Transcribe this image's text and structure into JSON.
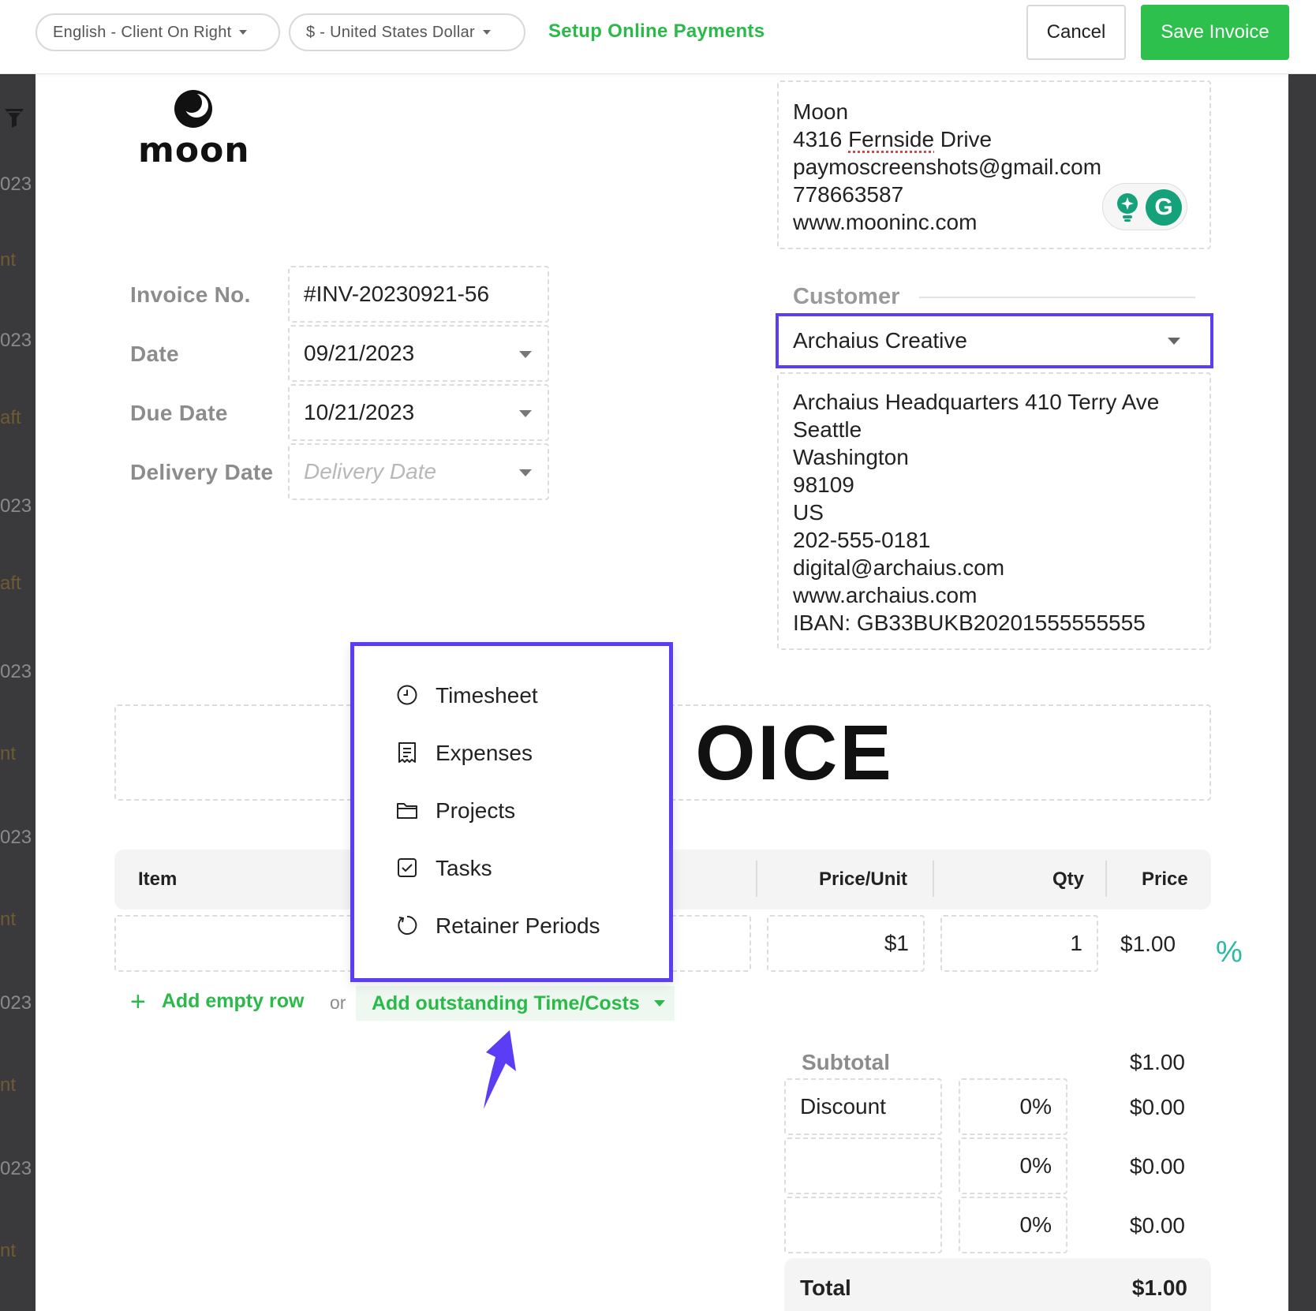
{
  "toolbar": {
    "language": "English - Client On Right",
    "currency": "$ - United States Dollar",
    "setup_payments": "Setup Online Payments",
    "cancel": "Cancel",
    "save": "Save Invoice"
  },
  "left_rail": [
    "023",
    "nt",
    "023",
    "aft",
    "023",
    "aft",
    "023",
    "nt",
    "023",
    "nt",
    "023",
    "nt",
    "023",
    "nt"
  ],
  "logo": {
    "word": "moon"
  },
  "company": {
    "lines": [
      "Moon",
      "4316 Fernside Drive",
      "paymoscreenshots@gmail.com",
      "778663587",
      "www.mooninc.com"
    ],
    "address_prefix": "4316 ",
    "address_flagged": "Fernside",
    "address_suffix": " Drive"
  },
  "grammarly": {
    "letter": "G"
  },
  "invoice_fields": {
    "invoice_no_label": "Invoice No.",
    "invoice_no": "#INV-20230921-56",
    "date_label": "Date",
    "date": "09/21/2023",
    "due_date_label": "Due Date",
    "due_date": "10/21/2023",
    "delivery_date_label": "Delivery Date",
    "delivery_date_placeholder": "Delivery Date"
  },
  "customer": {
    "label": "Customer",
    "selected": "Archaius Creative",
    "lines": [
      "Archaius Headquarters 410 Terry Ave",
      "Seattle",
      "Washington",
      "98109",
      "US",
      "202-555-0181",
      "digital@archaius.com",
      "www.archaius.com",
      "IBAN: GB33BUKB20201555555555"
    ]
  },
  "title": {
    "visible_text": "OICE"
  },
  "table": {
    "headers": {
      "item": "Item",
      "price_unit": "Price/Unit",
      "qty": "Qty",
      "price": "Price"
    },
    "row": {
      "price_unit": "$1",
      "qty": "1",
      "price": "$1.00"
    },
    "percent_icon": "%"
  },
  "actions": {
    "plus": "+",
    "add_empty_row": "Add empty row",
    "or": "or",
    "add_outstanding": "Add outstanding Time/Costs"
  },
  "dropdown": {
    "items": [
      {
        "label": "Timesheet",
        "icon": "clock-icon"
      },
      {
        "label": "Expenses",
        "icon": "receipt-icon"
      },
      {
        "label": "Projects",
        "icon": "folder-icon"
      },
      {
        "label": "Tasks",
        "icon": "checkbox-icon"
      },
      {
        "label": "Retainer Periods",
        "icon": "refresh-icon"
      }
    ]
  },
  "summary": {
    "subtotal_label": "Subtotal",
    "subtotal": "$1.00",
    "discount_label": "Discount",
    "discount_pct": "0%",
    "discount_val": "$0.00",
    "tax1_pct": "0%",
    "tax1_val": "$0.00",
    "tax2_pct": "0%",
    "tax2_val": "$0.00",
    "total_label": "Total",
    "total": "$1.00"
  },
  "colors": {
    "accent_green": "#2ec04c",
    "highlight_purple": "#5b3df5",
    "percent_teal": "#2bb9a6"
  }
}
